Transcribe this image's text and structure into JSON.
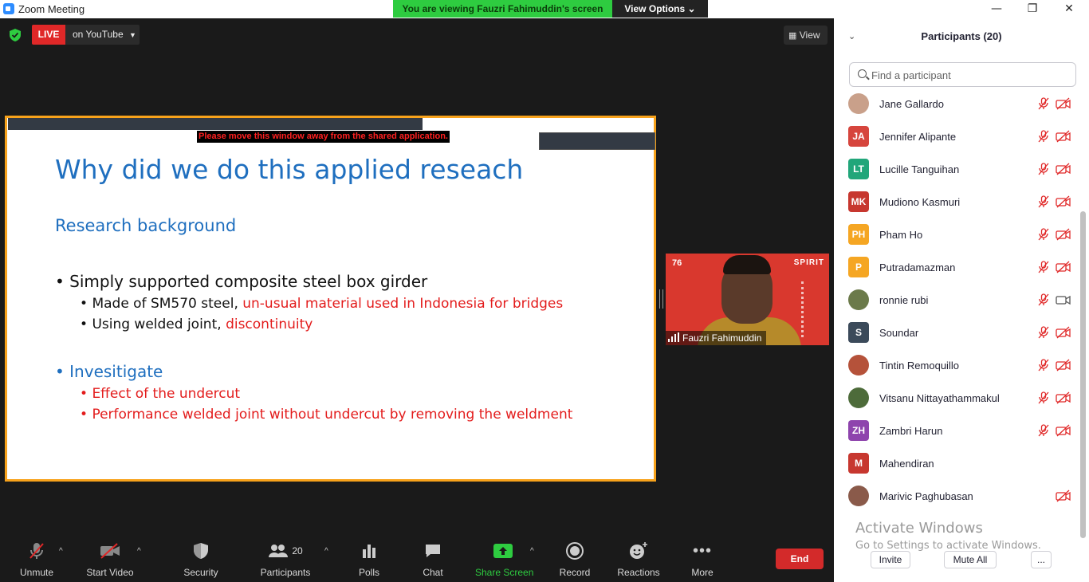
{
  "window": {
    "title": "Zoom Meeting",
    "viewing_banner": "You are viewing Fauzri Fahimuddin's screen",
    "view_options": "View Options",
    "minimize": "—",
    "restore": "❐",
    "close": "✕"
  },
  "meeting": {
    "live_badge": "LIVE",
    "live_destination": "on YouTube",
    "view_label": "View"
  },
  "slide": {
    "warning": "Please move this window away from the shared application.",
    "title": "Why did we do this applied reseach",
    "subtitle": "Research background",
    "b1": "Simply supported composite steel box girder",
    "b1_1_black": "Made of SM570 steel, ",
    "b1_1_red": "un-usual material used in Indonesia for bridges",
    "b1_2_black": "Using welded joint, ",
    "b1_2_red": "discontinuity",
    "b2": "Invesitigate",
    "b2_1": "Effect of the undercut",
    "b2_2": "Performance welded joint without undercut by removing the weldment"
  },
  "speaker": {
    "name": "Fauzri Fahimuddin",
    "banner_left": "76",
    "banner_right": "SPIRIT"
  },
  "toolbar": {
    "unmute": "Unmute",
    "start_video": "Start Video",
    "security": "Security",
    "participants": "Participants",
    "participants_count": "20",
    "polls": "Polls",
    "chat": "Chat",
    "share_screen": "Share Screen",
    "record": "Record",
    "reactions": "Reactions",
    "more": "More",
    "end": "End"
  },
  "panel": {
    "title": "Participants (20)",
    "search_placeholder": "Find a participant",
    "participants": [
      {
        "name": "Jane Gallardo",
        "initials": "",
        "color": "#c9a08a",
        "mic": "muted",
        "cam": "off"
      },
      {
        "name": "Jennifer Alipante",
        "initials": "JA",
        "color": "#d6453d",
        "mic": "muted",
        "cam": "off"
      },
      {
        "name": "Lucille Tanguihan",
        "initials": "LT",
        "color": "#21a67a",
        "mic": "muted",
        "cam": "off"
      },
      {
        "name": "Mudiono Kasmuri",
        "initials": "MK",
        "color": "#c7372f",
        "mic": "muted",
        "cam": "off"
      },
      {
        "name": "Pham Ho",
        "initials": "PH",
        "color": "#f5a623",
        "mic": "muted",
        "cam": "off"
      },
      {
        "name": "Putradamazman",
        "initials": "P",
        "color": "#f5a623",
        "mic": "muted",
        "cam": "off"
      },
      {
        "name": "ronnie rubi",
        "initials": "",
        "color": "#6b7a4a",
        "mic": "muted",
        "cam": "on"
      },
      {
        "name": "Soundar",
        "initials": "S",
        "color": "#3b4a5a",
        "mic": "muted",
        "cam": "off"
      },
      {
        "name": "Tintin Remoquillo",
        "initials": "",
        "color": "#b5523a",
        "mic": "muted",
        "cam": "off"
      },
      {
        "name": "Vitsanu Nittayathammakul",
        "initials": "",
        "color": "#4d6b3a",
        "mic": "muted",
        "cam": "off"
      },
      {
        "name": "Zambri Harun",
        "initials": "ZH",
        "color": "#8e44ad",
        "mic": "muted",
        "cam": "off"
      },
      {
        "name": "Mahendiran",
        "initials": "M",
        "color": "#c7372f",
        "mic": "none",
        "cam": "none"
      },
      {
        "name": "Marivic Paghubasan",
        "initials": "",
        "color": "#8a5a4a",
        "mic": "none",
        "cam": "off"
      }
    ],
    "watermark_1": "Activate Windows",
    "watermark_2": "Go to Settings to activate Windows.",
    "invite": "Invite",
    "mute_all": "Mute All",
    "more": "..."
  }
}
